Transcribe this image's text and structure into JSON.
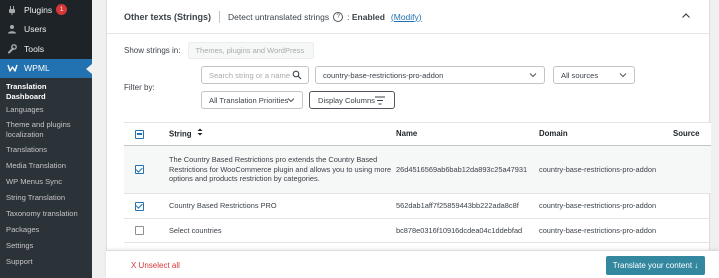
{
  "sidebar": {
    "top_items": [
      {
        "label": "Plugins",
        "badge": "1",
        "icon": "plugin-icon"
      },
      {
        "label": "Users",
        "icon": "users-icon"
      },
      {
        "label": "Tools",
        "icon": "wrench-icon"
      },
      {
        "label": "WPML",
        "icon": "wpml-icon"
      }
    ],
    "sub_items": [
      "Translation Dashboard",
      "Languages",
      "Theme and plugins localization",
      "Translations",
      "Media Translation",
      "WP Menus Sync",
      "String Translation",
      "Taxonomy translation",
      "Packages",
      "Settings",
      "Support"
    ]
  },
  "panel": {
    "title": "Other texts (Strings)",
    "detect_label": "Detect untranslated strings",
    "detect_status": "Enabled",
    "modify_link": "(Modify)",
    "show_strings_label": "Show strings in:",
    "show_strings_placeholder": "Themes, plugins and WordPress",
    "filter_label": "Filter by:",
    "search_placeholder": "Search string or a name",
    "domain_value": "country-base-restrictions-pro-addon",
    "sources_value": "All sources",
    "priorities_value": "All Translation Priorities",
    "display_columns_label": "Display Columns"
  },
  "table": {
    "headers": {
      "string": "String",
      "name": "Name",
      "domain": "Domain",
      "source": "Source"
    },
    "rows": [
      {
        "string": "The Country Based Restrictions pro extends the Country Based Restrictions for WooCommerce plugin and allows you to using more options and products restriction by categories.",
        "name": "26d4516569ab6bab12da893c25a47931",
        "domain": "country-base-restrictions-pro-addon",
        "checked": true
      },
      {
        "string": "Country Based Restrictions PRO",
        "name": "562dab1aff7f25859443bb222ada8c8f",
        "domain": "country-base-restrictions-pro-addon",
        "checked": true
      },
      {
        "string": "Select countries",
        "name": "bc878e0316f10916dcdea04c1ddebfad",
        "domain": "country-base-restrictions-pro-addon",
        "checked": false
      }
    ]
  },
  "footer": {
    "unselect_label": "X Unselect all",
    "translate_label": "Translate your content ↓"
  },
  "colors": {
    "sidebar_bg": "#1d2327",
    "active_blue": "#2271b1",
    "translate_button": "#33879e",
    "unselect_red": "#d63638"
  }
}
